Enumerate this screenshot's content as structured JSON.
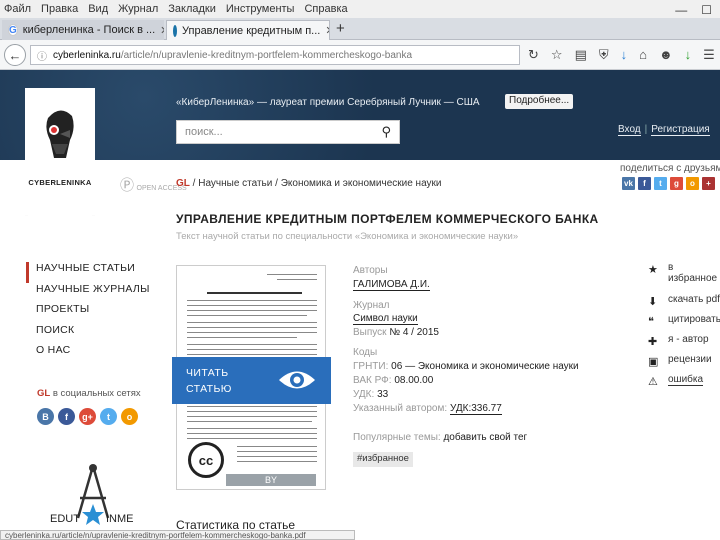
{
  "menubar": {
    "items": [
      "Файл",
      "Правка",
      "Вид",
      "Журнал",
      "Закладки",
      "Инструменты",
      "Справка"
    ]
  },
  "tabs": [
    {
      "title": "киберленинка - Поиск в ..."
    },
    {
      "title": "Управление кредитным п..."
    }
  ],
  "url": {
    "host": "cyberleninka.ru",
    "path": "/article/n/upravlenie-kreditnym-portfelem-kommercheskogo-banka"
  },
  "site": {
    "laureate": "«КиберЛенинка» — лауреат премии Серебряный Лучник — США",
    "more_button": "Подробнее...",
    "search_placeholder": "поиск...",
    "login": "Вход",
    "register": "Регистрация",
    "logo_text": "CYBERLENINKA",
    "oa_text": "OPEN ACCESS"
  },
  "breadcrumb": {
    "gl": "GL",
    "scientific": "Научные статьи",
    "category": "Экономика и экономические науки"
  },
  "share": {
    "label": "поделиться с друзьями"
  },
  "article": {
    "title": "УПРАВЛЕНИЕ КРЕДИТНЫМ ПОРТФЕЛЕМ КОММЕРЧЕСКОГО БАНКА",
    "subtitle": "Текст научной статьи по специальности «Экономика и экономические науки»",
    "read_button_line1": "ЧИТАТЬ",
    "read_button_line2": "СТАТЬЮ",
    "cc": "cc",
    "by": "BY"
  },
  "leftnav": {
    "items": [
      "НАУЧНЫЕ СТАТЬИ",
      "НАУЧНЫЕ ЖУРНАЛЫ",
      "ПРОЕКТЫ",
      "ПОИСК",
      "О НАС"
    ],
    "social_gl": "GL",
    "social_label": " в социальных сетях"
  },
  "meta": {
    "authors_label": "Авторы",
    "author": "ГАЛИМОВА Д.И.",
    "journal_label": "Журнал",
    "journal": "Символ науки",
    "issue_label": "Выпуск",
    "issue": "№ 4 / 2015",
    "codes_label": "Коды",
    "grnti_label": "ГРНТИ: ",
    "grnti": "06 — Экономика и экономические науки",
    "vak_label": "ВАК РФ: ",
    "vak": "08.00.00",
    "udk_label": "УДК: ",
    "udk": "33",
    "author_udk_label": "Указанный автором: ",
    "author_udk": "УДК:336.77",
    "topics_label": "Популярные темы: ",
    "topics_link": "добавить свой тег",
    "tag": "#избранное",
    "stats_title": "Статистика по статье"
  },
  "actions": [
    {
      "icon": "star",
      "label": "в избранное"
    },
    {
      "icon": "download",
      "label": "скачать pdf"
    },
    {
      "icon": "quote",
      "label": "цитировать"
    },
    {
      "icon": "author",
      "label": "я - автор"
    },
    {
      "icon": "review",
      "label": "рецензии"
    },
    {
      "icon": "error",
      "label": "ошибка"
    }
  ],
  "statusbar": "cyberleninka.ru/article/n/upravlenie-kreditnym-portfelem-kommercheskogo-banka.pdf",
  "edut": {
    "left": "EDUT",
    "right": "INME"
  },
  "colors": {
    "header_bg": "#1c3550",
    "accent_red": "#c0392b",
    "read_button": "#2a6ebb"
  }
}
